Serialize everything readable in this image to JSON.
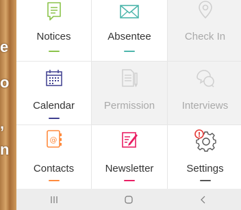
{
  "background_fragments": [
    "e",
    "o",
    "n",
    ","
  ],
  "tiles": [
    {
      "label": "Notices",
      "icon": "notice-board-icon",
      "accent": "#8bc34a",
      "enabled": true
    },
    {
      "label": "Absentee",
      "icon": "envelope-icon",
      "accent": "#4db6ac",
      "enabled": true
    },
    {
      "label": "Check In",
      "icon": "location-pin-icon",
      "accent": "#cccccc",
      "enabled": false
    },
    {
      "label": "Calendar",
      "icon": "calendar-icon",
      "accent": "#3f3f8f",
      "enabled": true
    },
    {
      "label": "Permission",
      "icon": "document-pen-icon",
      "accent": "#cccccc",
      "enabled": false
    },
    {
      "label": "Interviews",
      "icon": "chat-bubbles-icon",
      "accent": "#cccccc",
      "enabled": false
    },
    {
      "label": "Contacts",
      "icon": "address-book-icon",
      "accent": "#ff8a3d",
      "enabled": true
    },
    {
      "label": "Newsletter",
      "icon": "newsletter-edit-icon",
      "accent": "#e91e63",
      "enabled": true
    },
    {
      "label": "Settings",
      "icon": "gear-alert-icon",
      "accent": "#555555",
      "enabled": true,
      "badge": "!"
    }
  ],
  "navbar": {
    "recent": {
      "glyph": "|||",
      "icon": "recent-apps-icon"
    },
    "home": {
      "glyph": "○",
      "icon": "home-icon"
    },
    "back": {
      "glyph": "‹",
      "icon": "back-icon"
    }
  }
}
